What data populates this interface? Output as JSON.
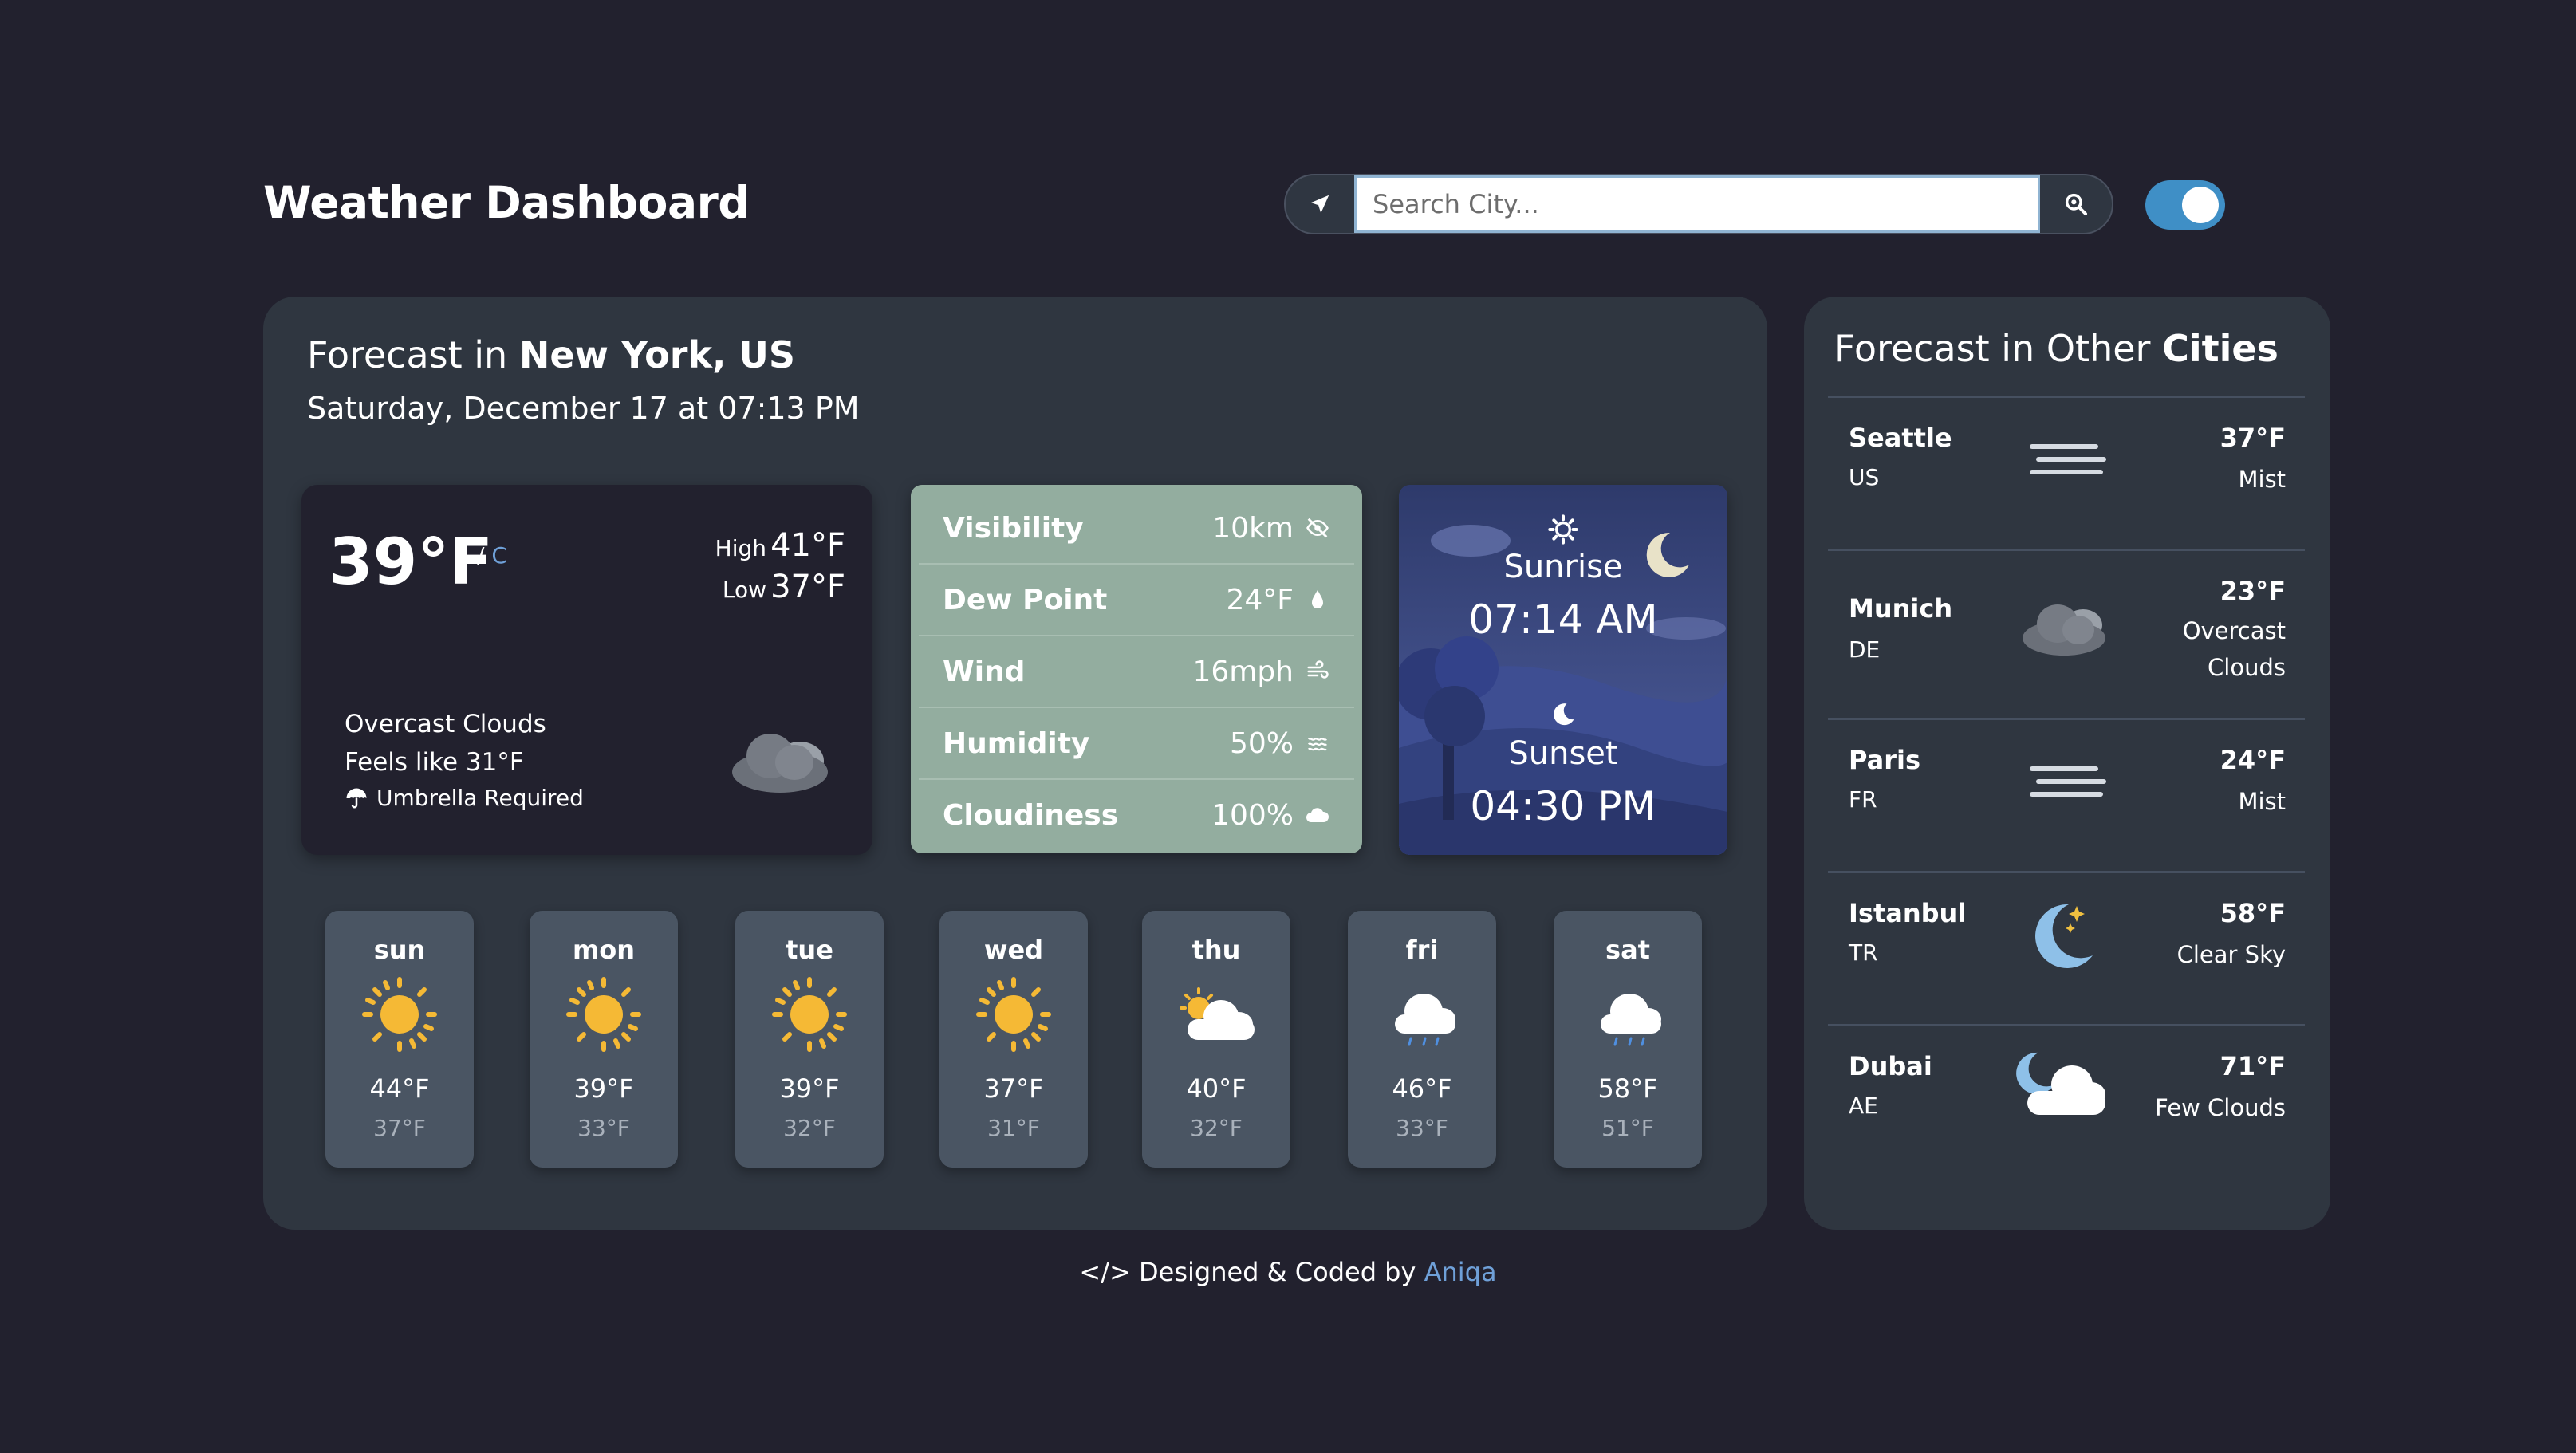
{
  "header": {
    "title": "Weather Dashboard",
    "search_placeholder": "Search City...",
    "locate_icon": "location-arrow-icon",
    "search_icon": "search-icon",
    "theme_toggle_on": true
  },
  "current": {
    "title_prefix": "Forecast in ",
    "city": "New York, US",
    "date": "Saturday, December 17 at 07:13 PM",
    "temp": "39°F",
    "unit_sep": "/",
    "unit_alt": "C",
    "high_label": "High",
    "high": "41°F",
    "low_label": "Low",
    "low": "37°F",
    "condition": "Overcast Clouds",
    "feels_like": "Feels like 31°F",
    "umbrella": "Umbrella Required"
  },
  "stats": [
    {
      "label": "Visibility",
      "value": "10km",
      "icon": "eye-slash-icon"
    },
    {
      "label": "Dew Point",
      "value": "24°F",
      "icon": "droplet-icon"
    },
    {
      "label": "Wind",
      "value": "16mph",
      "icon": "wind-icon"
    },
    {
      "label": "Humidity",
      "value": "50%",
      "icon": "humidity-icon"
    },
    {
      "label": "Cloudiness",
      "value": "100%",
      "icon": "cloud-icon"
    }
  ],
  "sun": {
    "sunrise_label": "Sunrise",
    "sunrise": "07:14 AM",
    "sunset_label": "Sunset",
    "sunset": "04:30 PM"
  },
  "daily": [
    {
      "day": "sun",
      "high": "44°F",
      "low": "37°F",
      "icon": "sun"
    },
    {
      "day": "mon",
      "high": "39°F",
      "low": "33°F",
      "icon": "sun"
    },
    {
      "day": "tue",
      "high": "39°F",
      "low": "32°F",
      "icon": "sun"
    },
    {
      "day": "wed",
      "high": "37°F",
      "low": "31°F",
      "icon": "sun"
    },
    {
      "day": "thu",
      "high": "40°F",
      "low": "32°F",
      "icon": "partly-cloudy"
    },
    {
      "day": "fri",
      "high": "46°F",
      "low": "33°F",
      "icon": "rain"
    },
    {
      "day": "sat",
      "high": "58°F",
      "low": "51°F",
      "icon": "rain"
    }
  ],
  "other_cities": {
    "title_prefix": "Forecast in Other ",
    "title_bold": "Cities",
    "cities": [
      {
        "name": "Seattle",
        "country": "US",
        "temp": "37°F",
        "desc": [
          "Mist"
        ],
        "icon": "mist"
      },
      {
        "name": "Munich",
        "country": "DE",
        "temp": "23°F",
        "desc": [
          "Overcast",
          "Clouds"
        ],
        "icon": "overcast"
      },
      {
        "name": "Paris",
        "country": "FR",
        "temp": "24°F",
        "desc": [
          "Mist"
        ],
        "icon": "mist"
      },
      {
        "name": "Istanbul",
        "country": "TR",
        "temp": "58°F",
        "desc": [
          "Clear Sky"
        ],
        "icon": "moon"
      },
      {
        "name": "Dubai",
        "country": "AE",
        "temp": "71°F",
        "desc": [
          "Few Clouds"
        ],
        "icon": "night-cloud"
      }
    ]
  },
  "footer": {
    "prefix": "</> Designed & Coded by ",
    "author": "Aniqa"
  }
}
